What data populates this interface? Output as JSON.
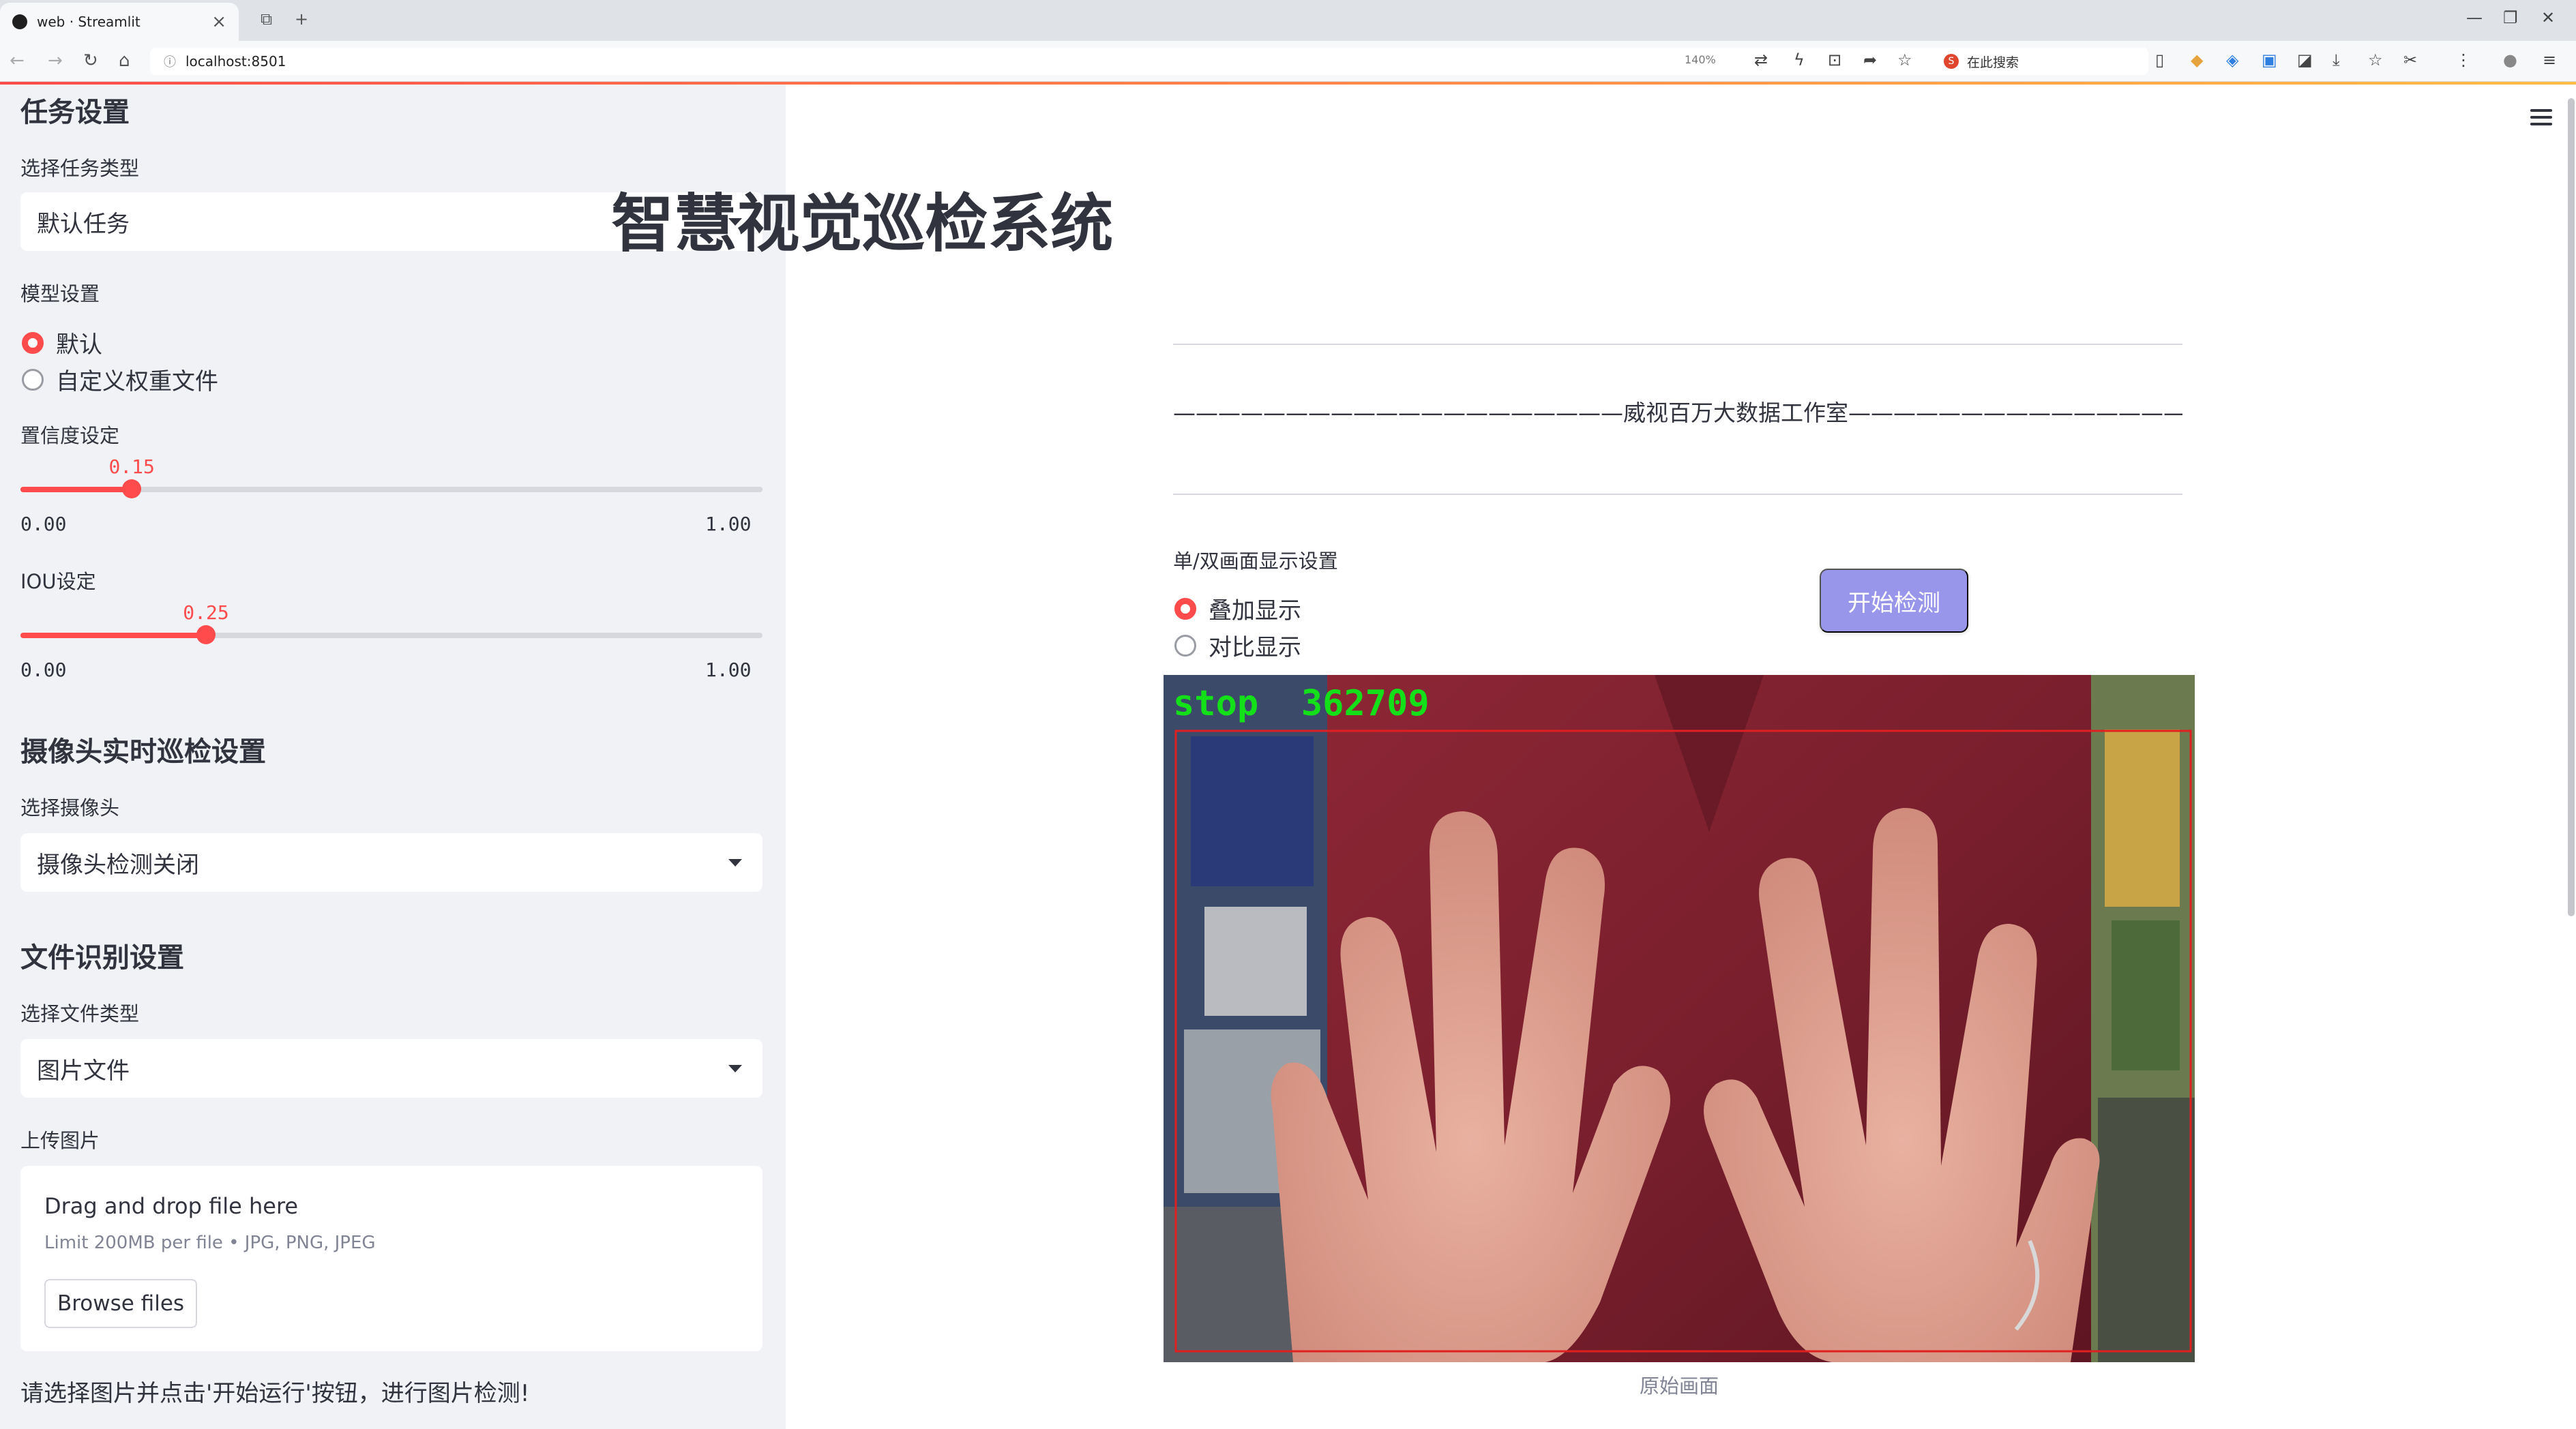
{
  "browser": {
    "tab_title": "web · Streamlit",
    "url": "localhost:8501",
    "zoom": "140%",
    "search_placeholder": "在此搜索"
  },
  "sidebar": {
    "task_heading": "任务设置",
    "task_type_label": "选择任务类型",
    "task_type_value": "默认任务",
    "model_label": "模型设置",
    "model_options": [
      "默认",
      "自定义权重文件"
    ],
    "model_selected": 0,
    "conf_label": "置信度设定",
    "conf": {
      "value": "0.15",
      "min": "0.00",
      "max": "1.00",
      "fraction": 0.15
    },
    "iou_label": "IOU设定",
    "iou": {
      "value": "0.25",
      "min": "0.00",
      "max": "1.00",
      "fraction": 0.25
    },
    "camera_heading": "摄像头实时巡检设置",
    "camera_label": "选择摄像头",
    "camera_value": "摄像头检测关闭",
    "file_heading": "文件识别设置",
    "file_type_label": "选择文件类型",
    "file_type_value": "图片文件",
    "upload_label": "上传图片",
    "upload": {
      "title": "Drag and drop file here",
      "limit": "Limit 200MB per file • JPG, PNG, JPEG",
      "browse": "Browse files"
    },
    "note": "请选择图片并点击'开始运行'按钮，进行图片检测!"
  },
  "main": {
    "title": "智慧视觉巡检系统",
    "subtitle": "————————————————————威视百万大数据工作室—————————————————————",
    "display_label": "单/双画面显示设置",
    "display_options": [
      "叠加显示",
      "对比显示"
    ],
    "display_selected": 0,
    "start_button": "开始检测",
    "detection_label": "stop  362709",
    "image_caption": "原始画面"
  },
  "colors": {
    "accent": "#ff4b4b",
    "button": "#9896ea",
    "sidebar_bg": "#f0f2f6",
    "detection_box": "#e02020",
    "detection_text": "#14e01a"
  }
}
